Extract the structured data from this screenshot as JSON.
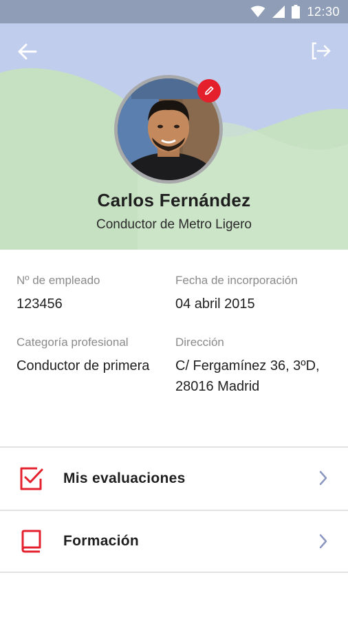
{
  "status_bar": {
    "time": "12:30",
    "icons": [
      "wifi-icon",
      "signal-icon",
      "battery-icon"
    ]
  },
  "header": {
    "back_icon": "arrow-left-icon",
    "logout_icon": "logout-icon",
    "edit_icon": "pencil-icon",
    "name": "Carlos Fernández",
    "role": "Conductor de Metro Ligero"
  },
  "employee": {
    "number_label": "Nº de empleado",
    "number_value": "123456",
    "joined_label": "Fecha de incorporación",
    "joined_value": "04 abril 2015",
    "category_label": "Categoría profesional",
    "category_value": "Conductor de primera",
    "address_label": "Dirección",
    "address_value": "C/ Fergamínez 36, 3ºD, 28016 Madrid"
  },
  "menu": {
    "items": [
      {
        "label": "Mis evaluaciones",
        "icon": "checkbox-icon"
      },
      {
        "label": "Formación",
        "icon": "book-icon"
      }
    ]
  },
  "colors": {
    "status_bar": "#8f9db7",
    "sky": "#c1cdec",
    "hills": "#c6e0c2",
    "accent_red": "#e3202c",
    "chevron": "#8a96c0"
  }
}
